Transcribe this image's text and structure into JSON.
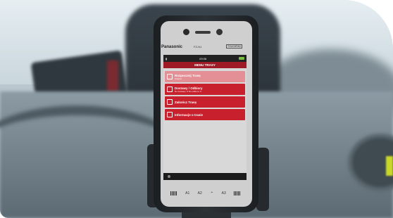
{
  "phone": {
    "brand": "Panasonic",
    "model": "FZ-N1",
    "rugged_label": "TOUGHPAD",
    "status_time": "09:08",
    "screen_title": "MENU TRASY",
    "menu_items": [
      {
        "label": "Rozpocznij Trasę",
        "sub": "Kraków",
        "enabled": false
      },
      {
        "label": "Dostawy / Odbiory",
        "sub": "Do dostawy: 0 Do odbioru: 0",
        "enabled": true
      },
      {
        "label": "Zakończ Trasę",
        "sub": "",
        "enabled": true
      },
      {
        "label": "Informacje o trasie",
        "sub": "",
        "enabled": true
      }
    ],
    "hardware_buttons": [
      "A1",
      "A2",
      "A3"
    ]
  }
}
